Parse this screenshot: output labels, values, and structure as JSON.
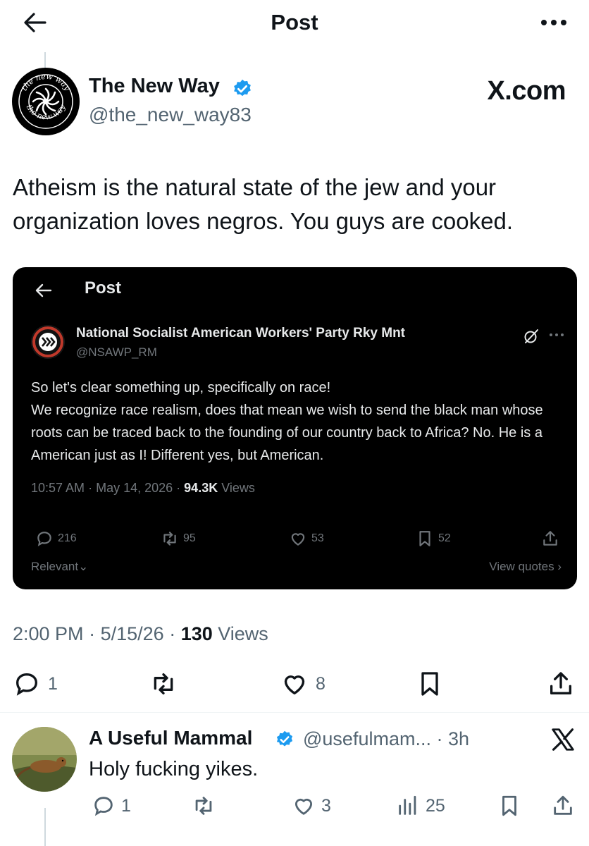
{
  "header": {
    "title": "Post",
    "back_icon": "arrow-left-icon",
    "more_icon": "more-horizontal-icon"
  },
  "post": {
    "author_name": "The New Way",
    "author_handle": "@the_new_way83",
    "avatar_text_top": "the new way",
    "avatar_text_bottom": "the new way",
    "watermark": "X.com",
    "text": "Atheism is the natural state of the jew and your organization loves negros. You guys are cooked.",
    "time": "2:00 PM",
    "date": "5/15/26",
    "views_count": "130",
    "views_label": "Views",
    "actions": {
      "replies": "1",
      "reposts": "",
      "likes": "8",
      "bookmarks": "",
      "share": ""
    }
  },
  "embed": {
    "title": "Post",
    "author_name": "National Socialist American Workers' Party Rky Mnt",
    "author_handle": "@NSAWP_RM",
    "body": [
      "So let's clear something up, specifically on race!",
      "We recognize race realism, does that mean we wish to send the black man whose roots can be traced back to the founding of our country back to Africa? No. He is a American just as I! Different yes, but American."
    ],
    "time": "10:57 AM",
    "date": "May 14, 2026",
    "views_count": "94.3K",
    "views_label": "Views",
    "replies": "216",
    "reposts": "95",
    "likes": "53",
    "bookmarks": "52",
    "relevant_label": "Relevant",
    "quotes_label": "View quotes"
  },
  "reply": {
    "author_name": "A Useful Mammal",
    "author_handle": "@usefulmam...",
    "time_ago": "· 3h",
    "text": "Holy fucking yikes.",
    "replies": "1",
    "reposts": "",
    "likes": "3",
    "views": "25"
  },
  "colors": {
    "verified_blue": "#1d9bf0",
    "secondary_text": "#536471",
    "embed_bg": "#000000",
    "divider": "#eff3f4"
  }
}
